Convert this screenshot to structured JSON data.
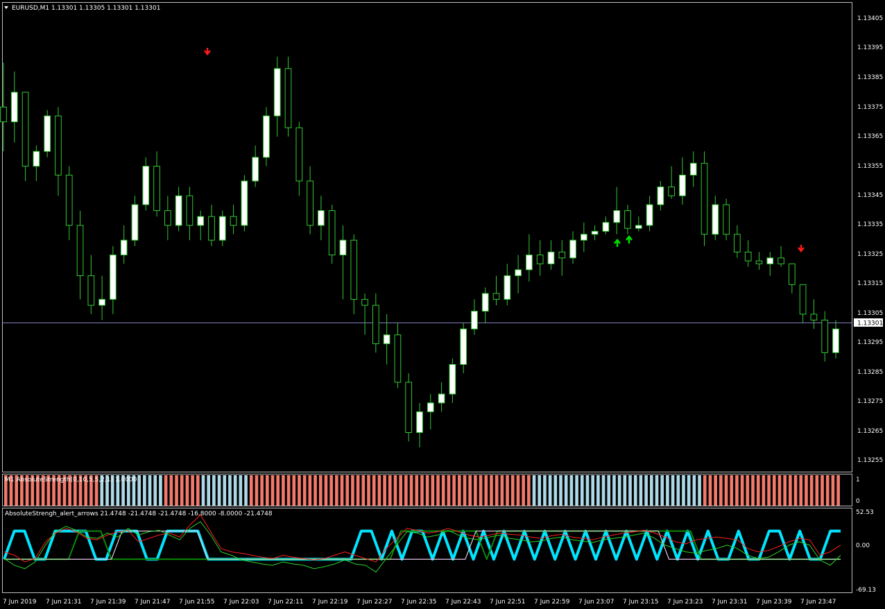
{
  "header": {
    "symbol_line": "EURUSD,M1  1.13301 1.13305 1.13301 1.13301",
    "menu_arrow": "triangle-down"
  },
  "colors": {
    "background": "#000000",
    "bull_fill": "#ffffff",
    "bull_wick": "#34c934",
    "bear_fill": "#000000",
    "bear_wick": "#34c934",
    "grid_frame": "#c0c0c0",
    "bid_line": "#8080c0",
    "arrow_down": "#ff1a1a",
    "arrow_up": "#00e000",
    "hist_bear": "#f27a6a",
    "hist_bull": "#add8e6",
    "line_red": "#ff2020",
    "line_green": "#2ad32a",
    "line_magenta": "#e040e0",
    "line_white": "#e8e8e8",
    "line_cyan": "#00e5ff",
    "line_darkgreen": "#0a8a0a"
  },
  "price_axis": {
    "ticks": [
      "1.13405",
      "1.13395",
      "1.13385",
      "1.13375",
      "1.13365",
      "1.13355",
      "1.13345",
      "1.13335",
      "1.13325",
      "1.13315",
      "1.13305",
      "1.13295",
      "1.13285",
      "1.13275",
      "1.13265",
      "1.13255"
    ],
    "current_price": "1.13301"
  },
  "time_axis": {
    "labels": [
      "7 Jun 2019",
      "7 Jun 21:31",
      "7 Jun 21:39",
      "7 Jun 21:47",
      "7 Jun 21:55",
      "7 Jun 22:03",
      "7 Jun 22:11",
      "7 Jun 22:19",
      "7 Jun 22:27",
      "7 Jun 22:35",
      "7 Jun 22:43",
      "7 Jun 22:51",
      "7 Jun 22:59",
      "7 Jun 23:07",
      "7 Jun 23:15",
      "7 Jun 23:23",
      "7 Jun 23:31",
      "7 Jun 23:39",
      "7 Jun 23:47"
    ]
  },
  "subwindow1": {
    "title": "M1 AbsoluteStrength(0,10,5,5,2,1) 1.0000",
    "axis_ticks": [
      "1",
      "0"
    ]
  },
  "subwindow2": {
    "title": "AbsoluteStrengh_alert_arrows 21.4748 -21.4748 -21.4748 -16.8000 -8.0000 -21.4748",
    "axis_ticks": [
      "52.53",
      "0.00",
      "-69.13"
    ]
  },
  "chart_data": {
    "type": "candlestick",
    "title": "EURUSD,M1",
    "ylim": [
      1.1325,
      1.1341
    ],
    "bar_count": 150,
    "candles": [
      [
        1.13375,
        1.1339,
        1.1336,
        1.1337
      ],
      [
        1.1337,
        1.13387,
        1.13363,
        1.1338
      ],
      [
        1.1338,
        1.1338,
        1.1335,
        1.13355
      ],
      [
        1.13355,
        1.13362,
        1.1335,
        1.1336
      ],
      [
        1.1336,
        1.13374,
        1.13358,
        1.13372
      ],
      [
        1.13372,
        1.13375,
        1.13345,
        1.13352
      ],
      [
        1.13352,
        1.13355,
        1.1333,
        1.13335
      ],
      [
        1.13335,
        1.1334,
        1.1331,
        1.13318
      ],
      [
        1.13318,
        1.13325,
        1.13305,
        1.13308
      ],
      [
        1.13308,
        1.13318,
        1.13303,
        1.1331
      ],
      [
        1.1331,
        1.13328,
        1.13305,
        1.13325
      ],
      [
        1.13325,
        1.13335,
        1.13322,
        1.1333
      ],
      [
        1.1333,
        1.13345,
        1.13328,
        1.13342
      ],
      [
        1.13342,
        1.13358,
        1.1334,
        1.13355
      ],
      [
        1.13355,
        1.1336,
        1.13338,
        1.1334
      ],
      [
        1.1334,
        1.13345,
        1.1333,
        1.13335
      ],
      [
        1.13335,
        1.13348,
        1.13333,
        1.13345
      ],
      [
        1.13345,
        1.13348,
        1.1333,
        1.13335
      ],
      [
        1.13335,
        1.1334,
        1.1333,
        1.13338
      ],
      [
        1.13338,
        1.13342,
        1.13328,
        1.1333
      ],
      [
        1.1333,
        1.1334,
        1.13328,
        1.13338
      ],
      [
        1.13338,
        1.13342,
        1.13332,
        1.13335
      ],
      [
        1.13335,
        1.13352,
        1.13333,
        1.1335
      ],
      [
        1.1335,
        1.13362,
        1.13348,
        1.13358
      ],
      [
        1.13358,
        1.13375,
        1.13355,
        1.13372
      ],
      [
        1.13372,
        1.13392,
        1.13365,
        1.13388
      ],
      [
        1.13388,
        1.13392,
        1.13365,
        1.13368
      ],
      [
        1.13368,
        1.1337,
        1.13345,
        1.1335
      ],
      [
        1.1335,
        1.13355,
        1.13332,
        1.13335
      ],
      [
        1.13335,
        1.13345,
        1.1333,
        1.1334
      ],
      [
        1.1334,
        1.13342,
        1.13322,
        1.13325
      ],
      [
        1.13325,
        1.13335,
        1.1331,
        1.1333
      ],
      [
        1.1333,
        1.13332,
        1.13305,
        1.1331
      ],
      [
        1.1331,
        1.13312,
        1.13298,
        1.13308
      ],
      [
        1.13308,
        1.13312,
        1.13292,
        1.13295
      ],
      [
        1.13295,
        1.13305,
        1.13288,
        1.13298
      ],
      [
        1.13298,
        1.13302,
        1.1328,
        1.13282
      ],
      [
        1.13282,
        1.13285,
        1.13262,
        1.13265
      ],
      [
        1.13265,
        1.13275,
        1.1326,
        1.13272
      ],
      [
        1.13272,
        1.13278,
        1.13266,
        1.13275
      ],
      [
        1.13275,
        1.13282,
        1.13272,
        1.13278
      ],
      [
        1.13278,
        1.1329,
        1.13275,
        1.13288
      ],
      [
        1.13288,
        1.13302,
        1.13285,
        1.133
      ],
      [
        1.133,
        1.1331,
        1.13298,
        1.13306
      ],
      [
        1.13306,
        1.13314,
        1.13302,
        1.13312
      ],
      [
        1.13312,
        1.13318,
        1.13308,
        1.1331
      ],
      [
        1.1331,
        1.13322,
        1.13308,
        1.13318
      ],
      [
        1.13318,
        1.13325,
        1.13312,
        1.1332
      ],
      [
        1.1332,
        1.13332,
        1.13316,
        1.13325
      ],
      [
        1.13325,
        1.1333,
        1.13318,
        1.13322
      ],
      [
        1.13322,
        1.1333,
        1.1332,
        1.13326
      ],
      [
        1.13326,
        1.1333,
        1.13318,
        1.13324
      ],
      [
        1.13324,
        1.13333,
        1.13322,
        1.1333
      ],
      [
        1.1333,
        1.13336,
        1.13326,
        1.13332
      ],
      [
        1.13332,
        1.13335,
        1.1333,
        1.13333
      ],
      [
        1.13333,
        1.13338,
        1.13332,
        1.13336
      ],
      [
        1.13336,
        1.13348,
        1.13332,
        1.1334
      ],
      [
        1.1334,
        1.13342,
        1.13332,
        1.13334
      ],
      [
        1.13334,
        1.13338,
        1.13333,
        1.13335
      ],
      [
        1.13335,
        1.13345,
        1.13333,
        1.13342
      ],
      [
        1.13342,
        1.1335,
        1.1334,
        1.13348
      ],
      [
        1.13348,
        1.13355,
        1.13344,
        1.13345
      ],
      [
        1.13345,
        1.13358,
        1.13342,
        1.13352
      ],
      [
        1.13352,
        1.1336,
        1.13348,
        1.13356
      ],
      [
        1.13356,
        1.1336,
        1.13328,
        1.13332
      ],
      [
        1.13332,
        1.13345,
        1.1333,
        1.13342
      ],
      [
        1.13342,
        1.13344,
        1.1333,
        1.13332
      ],
      [
        1.13332,
        1.13335,
        1.13324,
        1.13326
      ],
      [
        1.13326,
        1.1333,
        1.13321,
        1.13323
      ],
      [
        1.13323,
        1.13326,
        1.1332,
        1.13322
      ],
      [
        1.13322,
        1.13326,
        1.13318,
        1.13324
      ],
      [
        1.13324,
        1.13328,
        1.13321,
        1.13322
      ],
      [
        1.13322,
        1.1332,
        1.13312,
        1.13315
      ],
      [
        1.13315,
        1.13315,
        1.13302,
        1.13305
      ],
      [
        1.13305,
        1.1331,
        1.133,
        1.13303
      ],
      [
        1.13303,
        1.13306,
        1.13289,
        1.13292
      ],
      [
        1.13292,
        1.13303,
        1.1329,
        1.133
      ]
    ],
    "signals": [
      {
        "type": "sell",
        "bar_time": "7 Jun 21:55"
      },
      {
        "type": "buy",
        "bar_time": "7 Jun 23:11"
      },
      {
        "type": "buy",
        "bar_time": "7 Jun 23:13"
      },
      {
        "type": "sell",
        "bar_time": "7 Jun 23:42"
      }
    ],
    "histogram": {
      "type": "bar",
      "ylim": [
        0,
        1
      ],
      "segments": [
        {
          "color": "bear",
          "bars": 18
        },
        {
          "color": "bull",
          "bars": 12
        },
        {
          "color": "bear",
          "bars": 7
        },
        {
          "color": "bull",
          "bars": 9
        },
        {
          "color": "bear",
          "bars": 53
        },
        {
          "color": "bull",
          "bars": 32
        },
        {
          "color": "bear",
          "bars": 26
        }
      ]
    },
    "oscillator": {
      "type": "line",
      "ylim": [
        -69.13,
        52.53
      ],
      "series": [
        {
          "color": "line_cyan",
          "values": [
            -21,
            21,
            21,
            -21,
            -21,
            21,
            21,
            21,
            21,
            -21,
            -21,
            21,
            21,
            21,
            -21,
            -21,
            21,
            21,
            21,
            21,
            -21,
            -21,
            -21,
            -21,
            -21,
            -21,
            -21,
            -21,
            -21,
            -21,
            -21,
            -21,
            -21,
            -21,
            -21,
            21,
            21,
            -21,
            21,
            -21,
            21,
            21,
            -21,
            21,
            -21,
            21,
            -21,
            21,
            -21,
            21,
            -21,
            21,
            -21,
            21,
            -21,
            21,
            -21,
            21,
            -21,
            21,
            -21,
            21,
            -21,
            21,
            -21,
            21,
            -21,
            21,
            -21,
            21,
            -21,
            -21,
            21,
            -21,
            -21,
            21,
            21,
            -21,
            21,
            -21,
            -21,
            21,
            21
          ]
        },
        {
          "color": "line_magenta",
          "values": [
            -21,
            -21,
            -21,
            -21,
            -21,
            -21,
            -21,
            -21,
            -21,
            -21,
            -21,
            21,
            21,
            21,
            21,
            21,
            21,
            21,
            21,
            -21,
            -21,
            -21,
            -21,
            -21,
            -21,
            -21,
            -21,
            -21,
            -21,
            -21,
            -21,
            -21,
            -21,
            -21,
            -21,
            -21,
            -21,
            -21,
            -21,
            -21,
            -21,
            -21,
            -21,
            -21,
            21,
            21,
            21,
            21,
            21,
            21,
            21,
            21,
            21,
            21,
            21,
            21,
            21,
            21,
            21,
            21,
            21,
            21,
            -21,
            -21,
            -21,
            -21,
            -21,
            -21,
            -21,
            -21,
            -21,
            -21,
            -21,
            -21,
            -21,
            -21,
            -21,
            -21,
            -21
          ]
        },
        {
          "color": "line_darkgreen",
          "values": [
            -21,
            -21,
            -21,
            -21,
            -21,
            -21,
            -21,
            21,
            21,
            21,
            -21,
            -21,
            -21,
            -21,
            -21,
            -21,
            -21,
            -21,
            -21,
            -21,
            -21,
            -21,
            -21,
            -21,
            -21,
            -21,
            -21,
            -21,
            -21,
            -21,
            -21,
            -21,
            -21,
            -21,
            -21,
            -21,
            -21,
            21,
            21,
            21,
            21,
            21,
            21,
            21,
            21,
            -21,
            21,
            21,
            21,
            21,
            21,
            21,
            21,
            21,
            21,
            21,
            21,
            21,
            21,
            21,
            21,
            21,
            21,
            21,
            21,
            -21,
            -21,
            -21,
            -21,
            -21,
            -21,
            -21,
            -21,
            -21,
            -21,
            -21,
            -21,
            -21,
            -21
          ]
        },
        {
          "color": "line_white",
          "values": [
            -21,
            -21,
            -21,
            -21,
            -21,
            -21,
            -21,
            -21,
            -21,
            -21,
            -21,
            21,
            21,
            21,
            21,
            21,
            21,
            21,
            21,
            -21,
            -21,
            -21,
            -21,
            -21,
            -21,
            -21,
            -21,
            -21,
            -21,
            -21,
            -21,
            -21,
            -21,
            -21,
            -21,
            -21,
            -21,
            -21,
            -21,
            -21,
            -21,
            -21,
            -21,
            -21,
            21,
            21,
            21,
            21,
            21,
            21,
            21,
            21,
            21,
            21,
            21,
            21,
            21,
            21,
            21,
            21,
            21,
            21,
            -21,
            -21,
            -21,
            -21,
            -21,
            -21,
            -21,
            -21,
            -21,
            -21,
            -21,
            -21,
            -21,
            -21,
            -21,
            -21,
            -21
          ]
        },
        {
          "color": "line_red",
          "values": [
            -10,
            -15,
            -25,
            -20,
            5,
            18,
            25,
            20,
            10,
            8,
            15,
            20,
            22,
            5,
            10,
            15,
            18,
            12,
            30,
            45,
            20,
            -5,
            -10,
            -12,
            -15,
            -18,
            -20,
            -15,
            -18,
            -20,
            -22,
            -20,
            -15,
            -10,
            -15,
            -20,
            -25,
            -5,
            10,
            25,
            22,
            18,
            20,
            25,
            20,
            15,
            12,
            15,
            18,
            16,
            15,
            12,
            10,
            14,
            16,
            12,
            10,
            8,
            12,
            15,
            18,
            20,
            22,
            18,
            12,
            5,
            2,
            8,
            10,
            12,
            10,
            8,
            -5,
            -10,
            -8,
            -2,
            5,
            10,
            8,
            -15,
            -10,
            0
          ]
        },
        {
          "color": "line_green",
          "values": [
            -20,
            -30,
            -35,
            -25,
            0,
            20,
            28,
            22,
            12,
            10,
            18,
            12,
            25,
            15,
            20,
            22,
            15,
            8,
            25,
            35,
            15,
            -10,
            -15,
            -22,
            -25,
            -28,
            -30,
            -25,
            -28,
            -30,
            -35,
            -32,
            -28,
            -22,
            -28,
            -30,
            -40,
            -20,
            0,
            20,
            18,
            12,
            15,
            22,
            15,
            10,
            8,
            12,
            15,
            10,
            8,
            5,
            6,
            10,
            12,
            8,
            6,
            4,
            8,
            10,
            12,
            15,
            18,
            10,
            0,
            -5,
            -10,
            -12,
            -8,
            -5,
            0,
            -5,
            -15,
            -20,
            -18,
            -10,
            0,
            5,
            0,
            -22,
            -30,
            -15
          ]
        }
      ]
    }
  }
}
